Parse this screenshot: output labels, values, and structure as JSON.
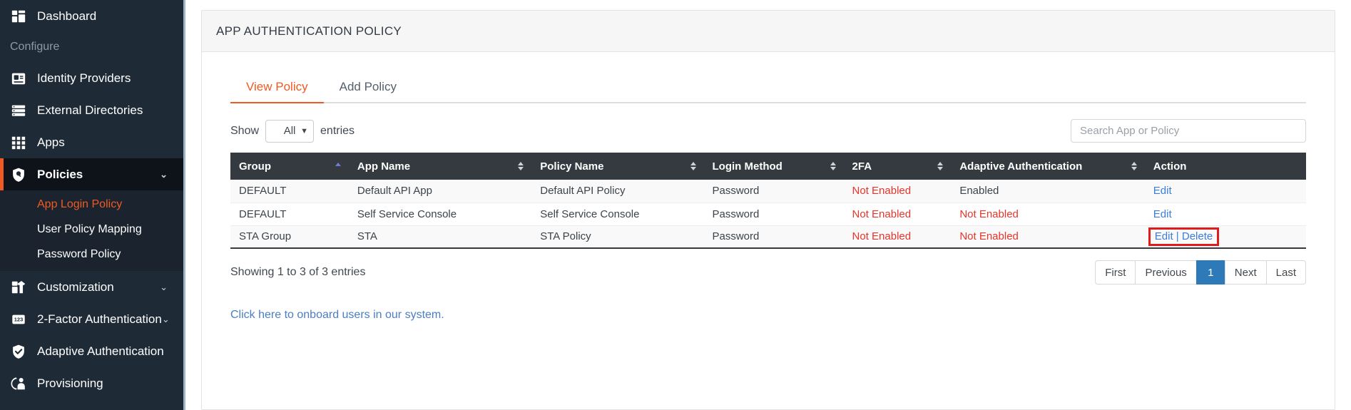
{
  "sidebar": {
    "items": [
      {
        "type": "item",
        "label": "Dashboard",
        "icon": "dashboard-icon",
        "chevron": false,
        "active": false
      },
      {
        "type": "section",
        "label": "Configure"
      },
      {
        "type": "item",
        "label": "Identity Providers",
        "icon": "id-card-icon",
        "chevron": false,
        "active": false
      },
      {
        "type": "item",
        "label": "External Directories",
        "icon": "server-list-icon",
        "chevron": false,
        "active": false
      },
      {
        "type": "item",
        "label": "Apps",
        "icon": "grid-apps-icon",
        "chevron": false,
        "active": false
      },
      {
        "type": "item",
        "label": "Policies",
        "icon": "shield-policy-icon",
        "chevron": true,
        "active": true
      },
      {
        "type": "submenu",
        "items": [
          {
            "label": "App Login Policy",
            "selected": true
          },
          {
            "label": "User Policy Mapping",
            "selected": false
          },
          {
            "label": "Password Policy",
            "selected": false
          }
        ]
      },
      {
        "type": "item",
        "label": "Customization",
        "icon": "customization-icon",
        "chevron": true,
        "active": false
      },
      {
        "type": "item",
        "label": "2-Factor Authentication",
        "icon": "numeric-123-icon",
        "chevron": true,
        "active": false
      },
      {
        "type": "item",
        "label": "Adaptive Authentication",
        "icon": "shield-check-icon",
        "chevron": false,
        "active": false
      },
      {
        "type": "item",
        "label": "Provisioning",
        "icon": "provisioning-user-icon",
        "chevron": false,
        "active": false
      }
    ]
  },
  "card": {
    "title": "APP AUTHENTICATION POLICY"
  },
  "tabs": [
    {
      "label": "View Policy",
      "active": true
    },
    {
      "label": "Add Policy",
      "active": false
    }
  ],
  "controls": {
    "show_label": "Show",
    "entries_label": "entries",
    "page_size_value": "All",
    "page_size_options": [
      "All"
    ],
    "search_placeholder": "Search App or Policy",
    "search_value": ""
  },
  "table": {
    "columns": [
      {
        "label": "Group",
        "sort": "asc"
      },
      {
        "label": "App Name",
        "sort": "none"
      },
      {
        "label": "Policy Name",
        "sort": "none"
      },
      {
        "label": "Login Method",
        "sort": "none"
      },
      {
        "label": "2FA",
        "sort": "none"
      },
      {
        "label": "Adaptive Authentication",
        "sort": "none"
      },
      {
        "label": "Action",
        "sort": "none"
      }
    ],
    "rows": [
      {
        "group": "DEFAULT",
        "app_name": "Default API App",
        "policy_name": "Default API Policy",
        "login_method": "Password",
        "twofa": "Not Enabled",
        "twofa_state": "disabled",
        "adaptive": "Enabled",
        "adaptive_state": "enabled",
        "actions": [
          "Edit"
        ],
        "action_highlighted": false
      },
      {
        "group": "DEFAULT",
        "app_name": "Self Service Console",
        "policy_name": "Self Service Console",
        "login_method": "Password",
        "twofa": "Not Enabled",
        "twofa_state": "disabled",
        "adaptive": "Not Enabled",
        "adaptive_state": "disabled",
        "actions": [
          "Edit"
        ],
        "action_highlighted": false
      },
      {
        "group": "STA Group",
        "app_name": "STA",
        "policy_name": "STA Policy",
        "login_method": "Password",
        "twofa": "Not Enabled",
        "twofa_state": "disabled",
        "adaptive": "Not Enabled",
        "adaptive_state": "disabled",
        "actions": [
          "Edit",
          "Delete"
        ],
        "action_separator": " | ",
        "action_highlighted": true
      }
    ]
  },
  "footer": {
    "showing": "Showing 1 to 3 of 3 entries",
    "pager": [
      {
        "label": "First",
        "current": false
      },
      {
        "label": "Previous",
        "current": false
      },
      {
        "label": "1",
        "current": true
      },
      {
        "label": "Next",
        "current": false
      },
      {
        "label": "Last",
        "current": false
      }
    ],
    "onboard_link": "Click here to onboard users in our system."
  },
  "colors": {
    "accent_orange": "#ef5a24",
    "sidebar_bg": "#1e2a36",
    "sidebar_active_bg": "#0d1319",
    "table_header_bg": "#343a40",
    "link_blue": "#3b7dd8",
    "error_red": "#e8342a",
    "highlight_red": "#e01b1b",
    "pager_active_blue": "#2e7ab8"
  }
}
